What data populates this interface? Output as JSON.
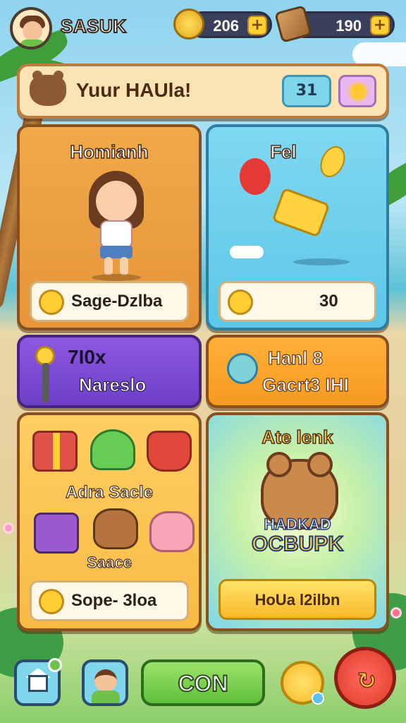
{
  "player": {
    "name": "SASUK"
  },
  "currency": {
    "coins": {
      "icon": "coin-icon",
      "amount": "206",
      "plus": "+"
    },
    "wood": {
      "icon": "wood-icon",
      "amount": "190",
      "plus": "+"
    }
  },
  "header": {
    "icon": "bear-icon",
    "title": "Yuur HAUla!",
    "count": "31",
    "sun_icon": "sun-icon"
  },
  "cards": {
    "character": {
      "title": "Homianh",
      "footer_icon": "leaf-coin-icon",
      "footer_text": "Sage-Dzlba"
    },
    "fel": {
      "title": "Fel",
      "footer_icon": "star-coin-icon",
      "footer_value": "30"
    },
    "purple": {
      "line1": "7I0x",
      "line2": "Nareslo"
    },
    "orange": {
      "line1": "Hanl 8",
      "line2": "Gacrt3 IHI"
    },
    "items": {
      "label1": "Adra Sacle",
      "label2": "Saace",
      "footer_text": "Sope- 3loa",
      "icons": [
        "gift-icon",
        "green-gem-icon",
        "basket-icon",
        "spellbook-icon",
        "fox-icon",
        "pig-icon"
      ]
    },
    "bonus": {
      "title": "Ate lenk",
      "big1": "HADKAD",
      "big2": "OCBUPK",
      "button": "HoUa l2ilbn"
    }
  },
  "nav": {
    "home_icon": "home-icon",
    "profile_icon": "profile-icon",
    "con": "CON",
    "sun_icon": "sun-icon",
    "next_icon": "next-arrow-icon"
  },
  "colors": {
    "sky": "#8fd3ef",
    "accent_gold": "#ffcf33",
    "purple": "#8d58e0",
    "green": "#5fbf3a",
    "red": "#e0392a"
  }
}
